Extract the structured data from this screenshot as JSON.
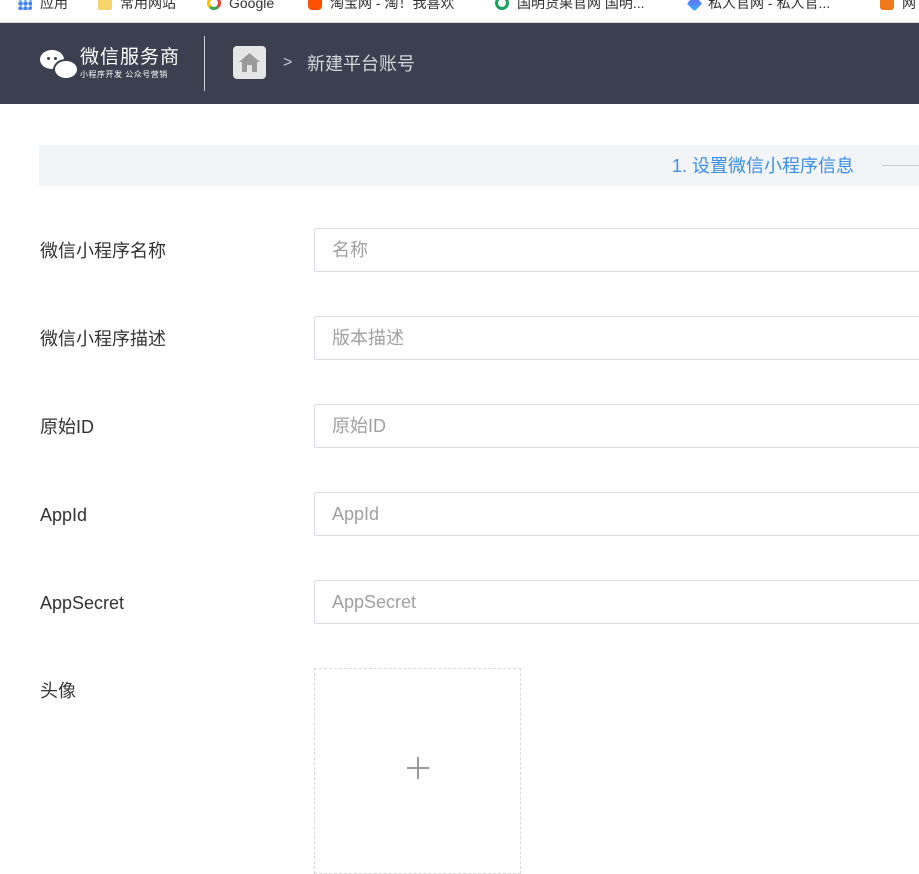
{
  "bookmarks": [
    {
      "label": "应用",
      "icon": "apps-icon"
    },
    {
      "label": "常用网站",
      "icon": "folder-icon"
    },
    {
      "label": "Google",
      "icon": "google-icon"
    },
    {
      "label": "淘宝网 - 淘！我喜欢",
      "icon": "taobao-icon"
    },
    {
      "label": "国明货果官网 国明...",
      "icon": "site-icon"
    },
    {
      "label": "私人官网 - 私人官...",
      "icon": "site-icon"
    },
    {
      "label": "网",
      "icon": "site-icon"
    }
  ],
  "header": {
    "logo_title": "微信服务商",
    "logo_subtitle": "小程序开发  公众号营销",
    "breadcrumb_separator": ">",
    "breadcrumb_current": "新建平台账号",
    "home_icon": "home-icon"
  },
  "steps": {
    "current_label": "1. 设置微信小程序信息"
  },
  "form": {
    "fields": [
      {
        "label": "微信小程序名称",
        "placeholder": "名称",
        "value": ""
      },
      {
        "label": "微信小程序描述",
        "placeholder": "版本描述",
        "value": ""
      },
      {
        "label": "原始ID",
        "placeholder": "原始ID",
        "value": ""
      },
      {
        "label": "AppId",
        "placeholder": "AppId",
        "value": ""
      },
      {
        "label": "AppSecret",
        "placeholder": "AppSecret",
        "value": ""
      }
    ],
    "avatar_label": "头像",
    "avatar_upload_icon": "plus-icon"
  },
  "colors": {
    "header_bg": "#3b3f4f",
    "accent": "#3a8ee6",
    "stepbar_bg": "#f3f4f7"
  }
}
